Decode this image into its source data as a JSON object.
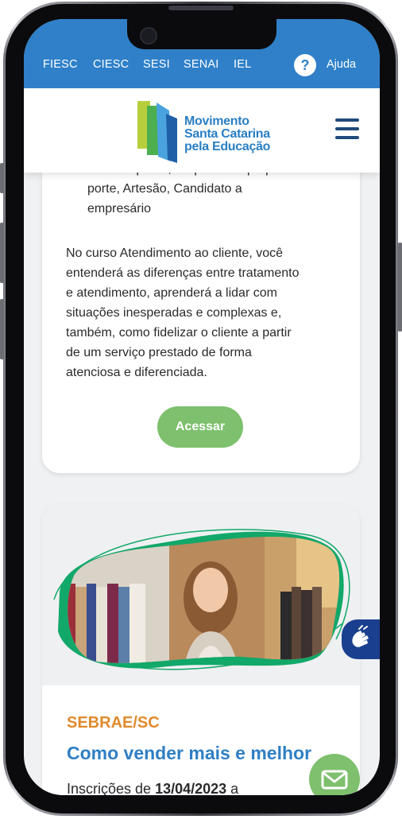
{
  "topbar": {
    "links": [
      "FIESC",
      "CIESC",
      "SESI",
      "SENAI",
      "IEL"
    ],
    "help_label": "Ajuda",
    "help_icon": "?"
  },
  "header": {
    "logo_line1": "Movimento",
    "logo_line2": "Santa Catarina",
    "logo_line3": "pela Educação"
  },
  "card1": {
    "audience_partial": "Microempresa, Empresa de pequeno",
    "audience_rest": [
      "porte, Artesão, Candidato a",
      "empresário"
    ],
    "description_lines": [
      "No curso Atendimento ao cliente, você",
      "entenderá as diferenças entre tratamento",
      "e atendimento, aprenderá a lidar com",
      "situações inesperadas e complexas e,",
      "também, como fidelizar o cliente a partir",
      "de um serviço prestado de forma",
      "atenciosa e diferenciada."
    ],
    "button_label": "Acessar"
  },
  "card2": {
    "organization": "SEBRAE/SC",
    "title": "Como vender mais e melhor",
    "dates_prefix": "Inscrições de ",
    "dates_start": "13/04/2023",
    "dates_suffix": " a"
  },
  "colors": {
    "brand_blue": "#2f80c9",
    "accent_green": "#7ec06e",
    "org_orange": "#e08a2c",
    "accessibility_navy": "#1b3f8f"
  },
  "icons": {
    "help": "help-icon",
    "menu": "hamburger-menu-icon",
    "accessibility": "sign-language-icon",
    "contact": "envelope-icon"
  }
}
